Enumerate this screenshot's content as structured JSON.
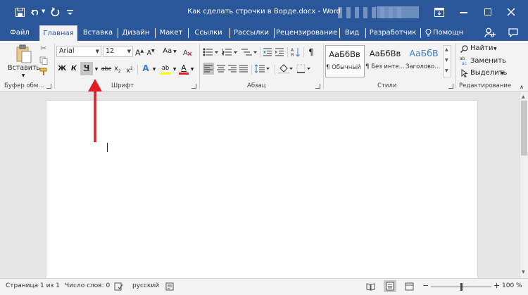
{
  "window": {
    "title": "Как сделать строчки в Ворде.docx - Word"
  },
  "tabs": [
    {
      "label": "Файл"
    },
    {
      "label": "Главная"
    },
    {
      "label": "Вставка"
    },
    {
      "label": "Дизайн"
    },
    {
      "label": "Макет"
    },
    {
      "label": "Ссылки"
    },
    {
      "label": "Рассылки"
    },
    {
      "label": "Рецензирование"
    },
    {
      "label": "Вид"
    },
    {
      "label": "Разработчик"
    },
    {
      "label": "Помощн"
    }
  ],
  "active_tab": "Главная",
  "ribbon": {
    "clipboard": {
      "paste_label": "Вставить",
      "group_label": "Буфер обм..."
    },
    "font": {
      "font_name": "Arial",
      "font_size": "12",
      "grow_label": "A",
      "shrink_label": "A",
      "case_label": "Aa",
      "bold_label": "Ж",
      "italic_label": "К",
      "underline_label": "Ч",
      "strike_label": "abc",
      "sub_label": "x",
      "sub_mark": "2",
      "sup_label": "x",
      "sup_mark": "2",
      "effects_label": "A",
      "highlight_label": "ab",
      "color_label": "A",
      "group_label": "Шрифт"
    },
    "paragraph": {
      "pilcrow": "¶",
      "group_label": "Абзац"
    },
    "styles": {
      "items": [
        {
          "preview": "АаБбВв",
          "name": "¶ Обычный"
        },
        {
          "preview": "АаБбВв",
          "name": "¶ Без инте..."
        },
        {
          "preview": "АаБбВ",
          "name": "Заголово..."
        }
      ],
      "group_label": "Стили"
    },
    "editing": {
      "find_label": "Найти",
      "replace_label": "Заменить",
      "select_label": "Выделить",
      "group_label": "Редактирование"
    }
  },
  "status": {
    "page": "Страница 1 из 1",
    "words": "Число слов: 0",
    "language": "русский",
    "zoom": "100 %",
    "zoom_level": 1.0
  },
  "colors": {
    "brand": "#2b579a",
    "arrow": "#e02020",
    "highlight": "#ffff00",
    "font_color": "#e02020"
  }
}
